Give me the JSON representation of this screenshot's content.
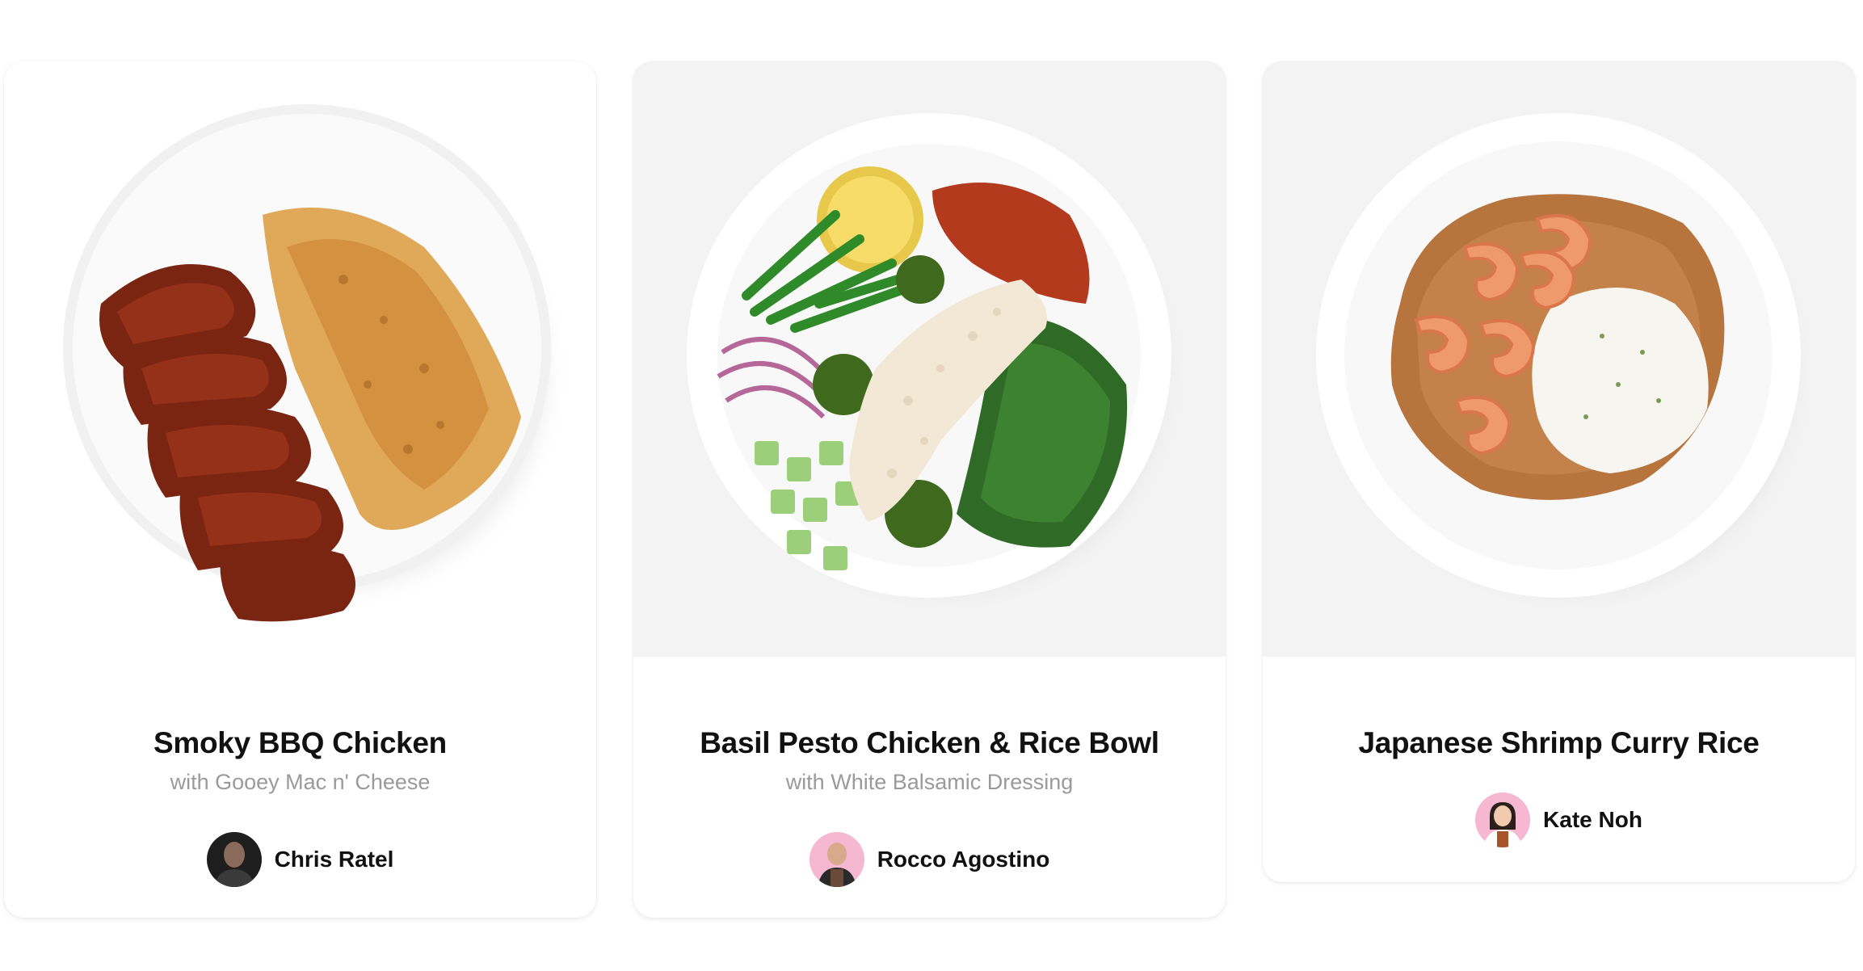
{
  "cards": [
    {
      "title": "Smoky BBQ Chicken",
      "subtitle": "with Gooey Mac n' Cheese",
      "chef": "Chris Ratel",
      "image": "bbq-chicken-mac-and-cheese-plate"
    },
    {
      "title": "Basil Pesto Chicken & Rice Bowl",
      "subtitle": "with White Balsamic Dressing",
      "chef": "Rocco Agostino",
      "image": "pesto-chicken-rice-bowl"
    },
    {
      "title": "Japanese Shrimp Curry Rice",
      "subtitle": "",
      "chef": "Kate Noh",
      "image": "shrimp-curry-rice-plate"
    }
  ],
  "colors": {
    "card_bg": "#ffffff",
    "image_bg_gray": "#f3f3f3",
    "title": "#111111",
    "subtitle": "#9a9a9a",
    "avatar_pink": "#f5b8d0"
  }
}
